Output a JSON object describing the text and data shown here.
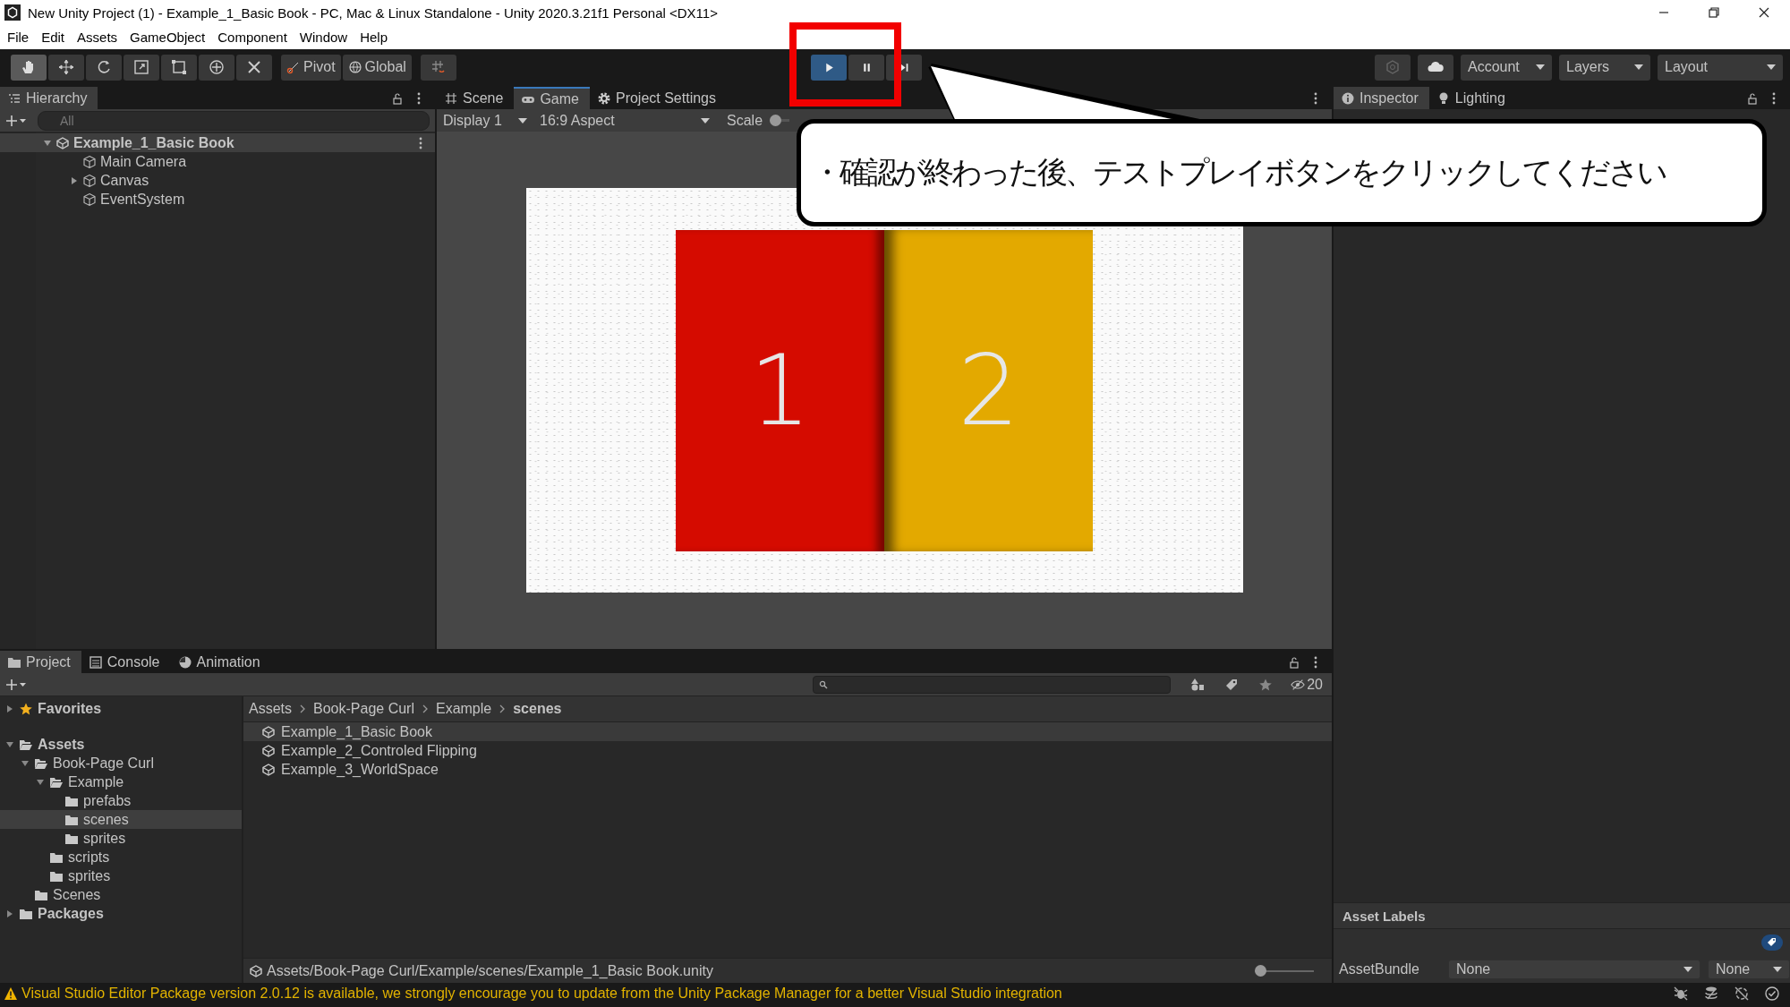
{
  "window": {
    "title": "New Unity Project (1) - Example_1_Basic Book - PC, Mac & Linux Standalone - Unity 2020.3.21f1 Personal <DX11>"
  },
  "menu": [
    "File",
    "Edit",
    "Assets",
    "GameObject",
    "Component",
    "Window",
    "Help"
  ],
  "toolbar": {
    "tools": [
      {
        "kind": "hand",
        "selected": true
      },
      {
        "kind": "move",
        "selected": false
      },
      {
        "kind": "rotate",
        "selected": false
      },
      {
        "kind": "scale",
        "selected": false
      },
      {
        "kind": "rect",
        "selected": false
      },
      {
        "kind": "transform",
        "selected": false
      },
      {
        "kind": "custom",
        "selected": false
      }
    ],
    "pivot": "Pivot",
    "global": "Global",
    "play": {
      "on": true
    },
    "pause": {
      "on": false
    },
    "account": "Account",
    "layers": "Layers",
    "layout": "Layout"
  },
  "hierarchy": {
    "title": "Hierarchy",
    "placeholder": "All",
    "tree": [
      {
        "name": "Example_1_Basic Book",
        "kind": "scene",
        "expanded": true,
        "selected": true,
        "children": [
          {
            "name": "Main Camera",
            "kind": "object",
            "selected": false
          },
          {
            "name": "Canvas",
            "kind": "object",
            "expanded": false,
            "selected": false
          },
          {
            "name": "EventSystem",
            "kind": "object",
            "selected": false
          }
        ]
      }
    ]
  },
  "view_tabs": [
    {
      "label": "Scene",
      "kind": "scene",
      "selected": false
    },
    {
      "label": "Game",
      "kind": "game",
      "selected": true
    },
    {
      "label": "Project Settings",
      "kind": "settings",
      "selected": false
    }
  ],
  "game_toolbar": {
    "display": "Display 1",
    "aspect": "16:9 Aspect",
    "scale": "Scale"
  },
  "game_view": {
    "pages": [
      {
        "label": "1",
        "color": "#d50b00"
      },
      {
        "label": "2",
        "color": "#e3a900"
      }
    ]
  },
  "inspector": {
    "tabs": [
      {
        "label": "Inspector",
        "selected": true
      },
      {
        "label": "Lighting",
        "selected": false
      }
    ],
    "asset_labels": "Asset Labels",
    "asset_bundle": {
      "label": "AssetBundle",
      "value": "None",
      "variant": "None"
    }
  },
  "project": {
    "tabs": [
      {
        "label": "Project",
        "kind": "project",
        "selected": true
      },
      {
        "label": "Console",
        "kind": "console",
        "selected": false
      },
      {
        "label": "Animation",
        "kind": "animation",
        "selected": false
      }
    ],
    "hidden_count": "20",
    "tree": [
      {
        "name": "Favorites",
        "kind": "favorites",
        "expanded": false,
        "selected": false
      },
      {
        "name": "Assets",
        "kind": "folder",
        "expanded": true,
        "selected": false,
        "children": [
          {
            "name": "Book-Page Curl",
            "kind": "folder",
            "expanded": true,
            "selected": false,
            "children": [
              {
                "name": "Example",
                "kind": "folder",
                "expanded": true,
                "selected": false,
                "children": [
                  {
                    "name": "prefabs",
                    "kind": "folder",
                    "selected": false
                  },
                  {
                    "name": "scenes",
                    "kind": "folder",
                    "selected": true
                  },
                  {
                    "name": "sprites",
                    "kind": "folder",
                    "selected": false
                  }
                ]
              },
              {
                "name": "scripts",
                "kind": "folder",
                "selected": false
              },
              {
                "name": "sprites",
                "kind": "folder",
                "selected": false
              }
            ]
          },
          {
            "name": "Scenes",
            "kind": "folder",
            "selected": false
          }
        ]
      },
      {
        "name": "Packages",
        "kind": "folder",
        "expanded": false,
        "selected": false
      }
    ],
    "breadcrumb": [
      "Assets",
      "Book-Page Curl",
      "Example",
      "scenes"
    ],
    "files": [
      {
        "name": "Example_1_Basic Book",
        "selected": true
      },
      {
        "name": "Example_2_Controled Flipping",
        "selected": false
      },
      {
        "name": "Example_3_WorldSpace",
        "selected": false
      }
    ],
    "path": "Assets/Book-Page Curl/Example/scenes/Example_1_Basic Book.unity",
    "zoom_slider": {
      "level": 0
    }
  },
  "status": {
    "message": "Visual Studio Editor Package version 2.0.12 is available, we strongly encourage you to update from the Unity Package Manager for a better Visual Studio integration"
  },
  "callout": {
    "text": "・確認が終わった後、テストプレイボタンをクリックしてください"
  }
}
